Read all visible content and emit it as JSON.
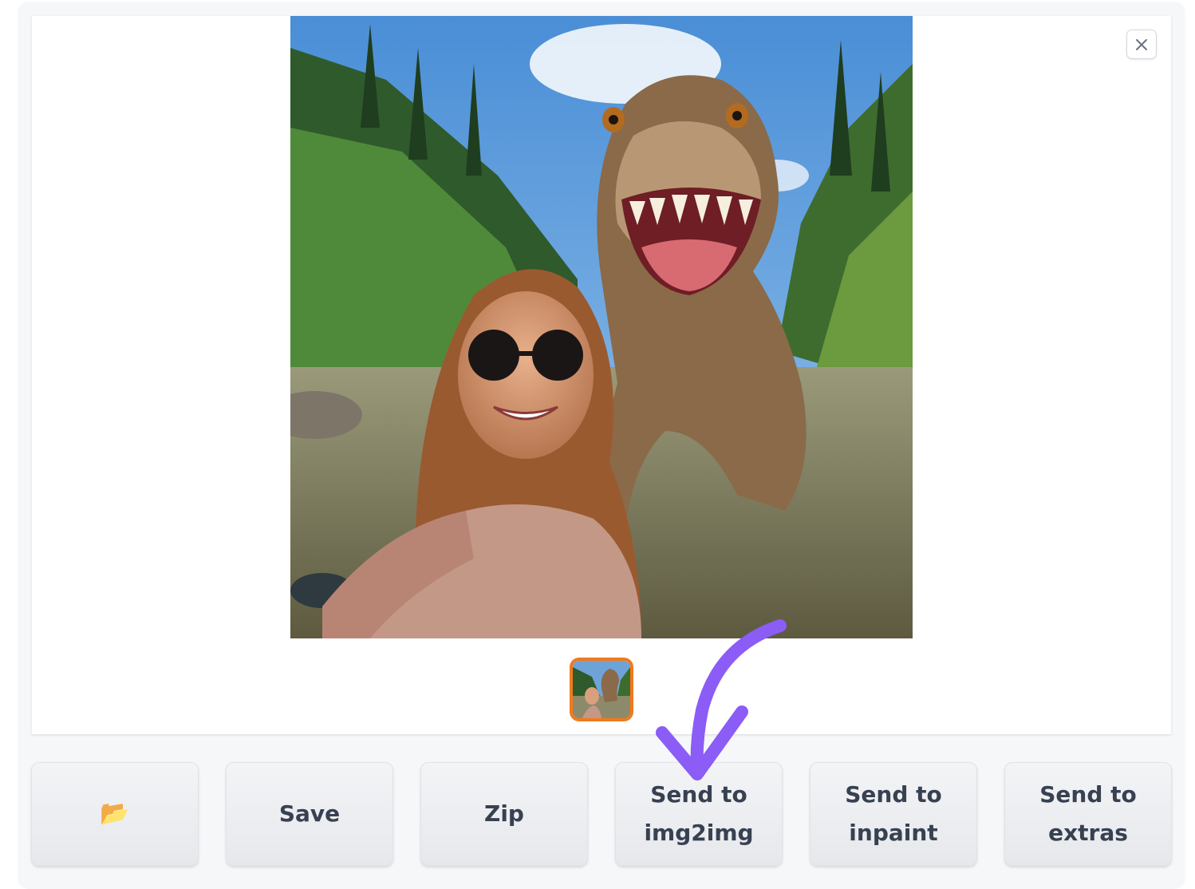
{
  "gallery": {
    "close_icon": "close-icon",
    "main_image_alt": "",
    "thumbnail_selected_color": "#f07a1c"
  },
  "actions": {
    "folder_icon": "folder-icon",
    "folder_glyph": "📂",
    "save_label": "Save",
    "zip_label": "Zip",
    "send_img2img_label": "Send to\nimg2img",
    "send_inpaint_label": "Send to\ninpaint",
    "send_extras_label": "Send to\nextras"
  },
  "annotation": {
    "arrow_color": "#8b5cf6"
  }
}
